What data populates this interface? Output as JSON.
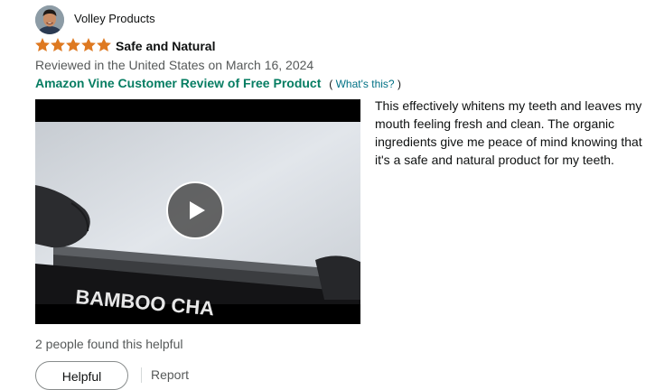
{
  "reviewer": {
    "name": "Volley Products"
  },
  "review": {
    "rating": 5,
    "rating_max": 5,
    "star_color": "#DE7921",
    "title": "Safe and Natural",
    "meta": "Reviewed in the United States on March 16, 2024",
    "vine_label": "Amazon Vine Customer Review of Free Product",
    "vine_open": "(",
    "vine_link": "What's this?",
    "vine_close": ")",
    "body": "This effectively whitens my teeth and leaves my mouth feeling fresh and clean. The organic ingredients give me peace of mind knowing that it's a safe and natural product for my teeth."
  },
  "video": {
    "overlay_text": "BAMBOO CHA",
    "play_icon": "play-icon"
  },
  "footer": {
    "helpful_count": "2 people found this helpful",
    "helpful_label": "Helpful",
    "report_label": "Report"
  }
}
